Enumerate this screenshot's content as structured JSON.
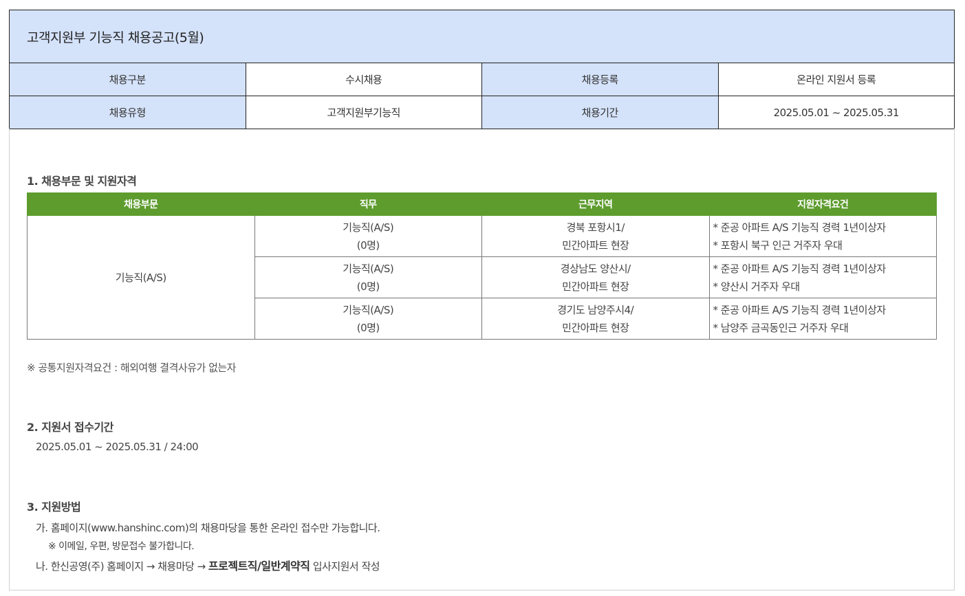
{
  "header": {
    "title": "고객지원부 기능직 채용공고(5월)"
  },
  "info_table": [
    [
      {
        "label": "채용구분",
        "value": "수시채용"
      },
      {
        "label": "채용등록",
        "value": "온라인 지원서 등록"
      }
    ],
    [
      {
        "label": "채용유형",
        "value": "고객지원부기능직"
      },
      {
        "label": "채용기간",
        "value": "2025.05.01 ~ 2025.05.31"
      }
    ]
  ],
  "section1": {
    "title": "1. 채용부문 및 지원자격",
    "columns": [
      "채용부문",
      "직무",
      "근무지역",
      "지원자격요건"
    ],
    "department": "기능직(A/S)",
    "rows": [
      {
        "duty": [
          "기능직(A/S)",
          "(0명)"
        ],
        "location": [
          "경북 포항시1/",
          "민간아파트 현장"
        ],
        "requirements": [
          "* 준공 아파트 A/S 기능직 경력 1년이상자",
          "* 포항시 북구 인근 거주자 우대"
        ]
      },
      {
        "duty": [
          "기능직(A/S)",
          "(0명)"
        ],
        "location": [
          "경상남도 양산시/",
          "민간아파트 현장"
        ],
        "requirements": [
          "* 준공 아파트 A/S 기능직 경력 1년이상자",
          "* 양산시 거주자 우대"
        ]
      },
      {
        "duty": [
          "기능직(A/S)",
          "(0명)"
        ],
        "location": [
          "경기도 남양주시4/",
          "민간아파트 현장"
        ],
        "requirements": [
          "* 준공 아파트 A/S 기능직 경력 1년이상자",
          "* 남양주 금곡동인근 거주자 우대"
        ]
      }
    ],
    "note": "※ 공통지원자격요건 : 해외여행 결격사유가 없는자"
  },
  "section2": {
    "title": "2. 지원서 접수기간",
    "text": "2025.05.01 ~ 2025.05.31 / 24:00"
  },
  "section3": {
    "title": "3. 지원방법",
    "line1": "가. 홈페이지(www.hanshinc.com)의 채용마당을 통한 온라인 접수만 가능합니다.",
    "line2": "※ 이메일, 우편, 방문접수 불가합니다.",
    "line3_prefix": "나. 한신공영(주) 홈페이지 → 채용마당 → ",
    "line3_bold": "프로젝트직/일반계약직",
    "line3_suffix": " 입사지원서 작성"
  },
  "colors": {
    "header_bg": "#d4e2fa",
    "table_header_green": "#5e9c2e"
  }
}
